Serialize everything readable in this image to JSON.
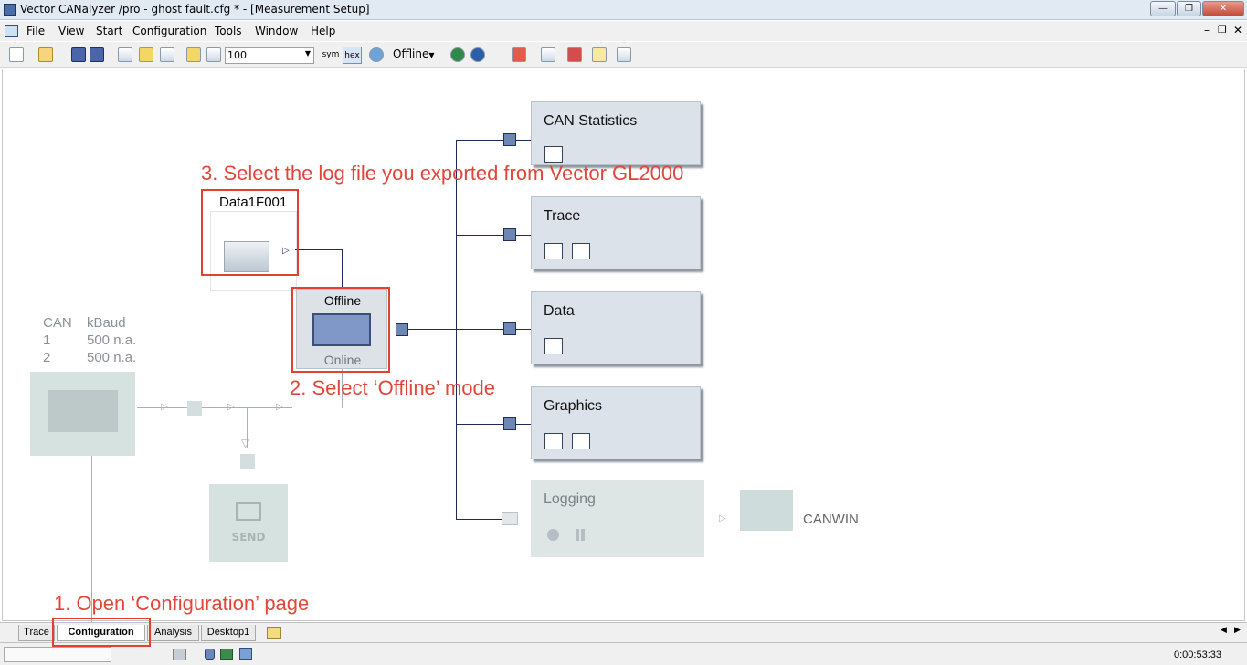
{
  "window": {
    "title": "Vector CANalyzer /pro  - ghost fault.cfg * - [Measurement Setup]"
  },
  "menu": [
    "File",
    "View",
    "Start",
    "Configuration",
    "Tools",
    "Window",
    "Help"
  ],
  "toolbar": {
    "zoom_value": "100",
    "sym_label": "sym",
    "hex_label": "hex",
    "mode_label": "Offline"
  },
  "source": {
    "filename": "Data1F001"
  },
  "mode_switch": {
    "top_label": "Offline",
    "bottom_label": "Online"
  },
  "can_info": {
    "header": [
      "CAN",
      "kBaud"
    ],
    "rows": [
      [
        "1",
        "500 n.a."
      ],
      [
        "2",
        "500 n.a."
      ]
    ]
  },
  "send_block": {
    "label": "SEND"
  },
  "windows": [
    {
      "label": "CAN Statistics"
    },
    {
      "label": "Trace"
    },
    {
      "label": "Data"
    },
    {
      "label": "Graphics"
    },
    {
      "label": "Logging"
    }
  ],
  "logging_target": {
    "label": "CANWIN"
  },
  "annotations": {
    "step1": "1. Open ‘Configuration’ page",
    "step2": "2. Select ‘Offline’ mode",
    "step3": "3. Select the log file you exported from Vector GL2000"
  },
  "tabs": [
    "Trace",
    "Configuration",
    "Analysis",
    "Desktop1"
  ],
  "status": {
    "time": "0:00:53:33"
  },
  "colors": {
    "annotation": "#e2463a",
    "block": "#dbe2e9",
    "connector": "#1c2b5a"
  }
}
